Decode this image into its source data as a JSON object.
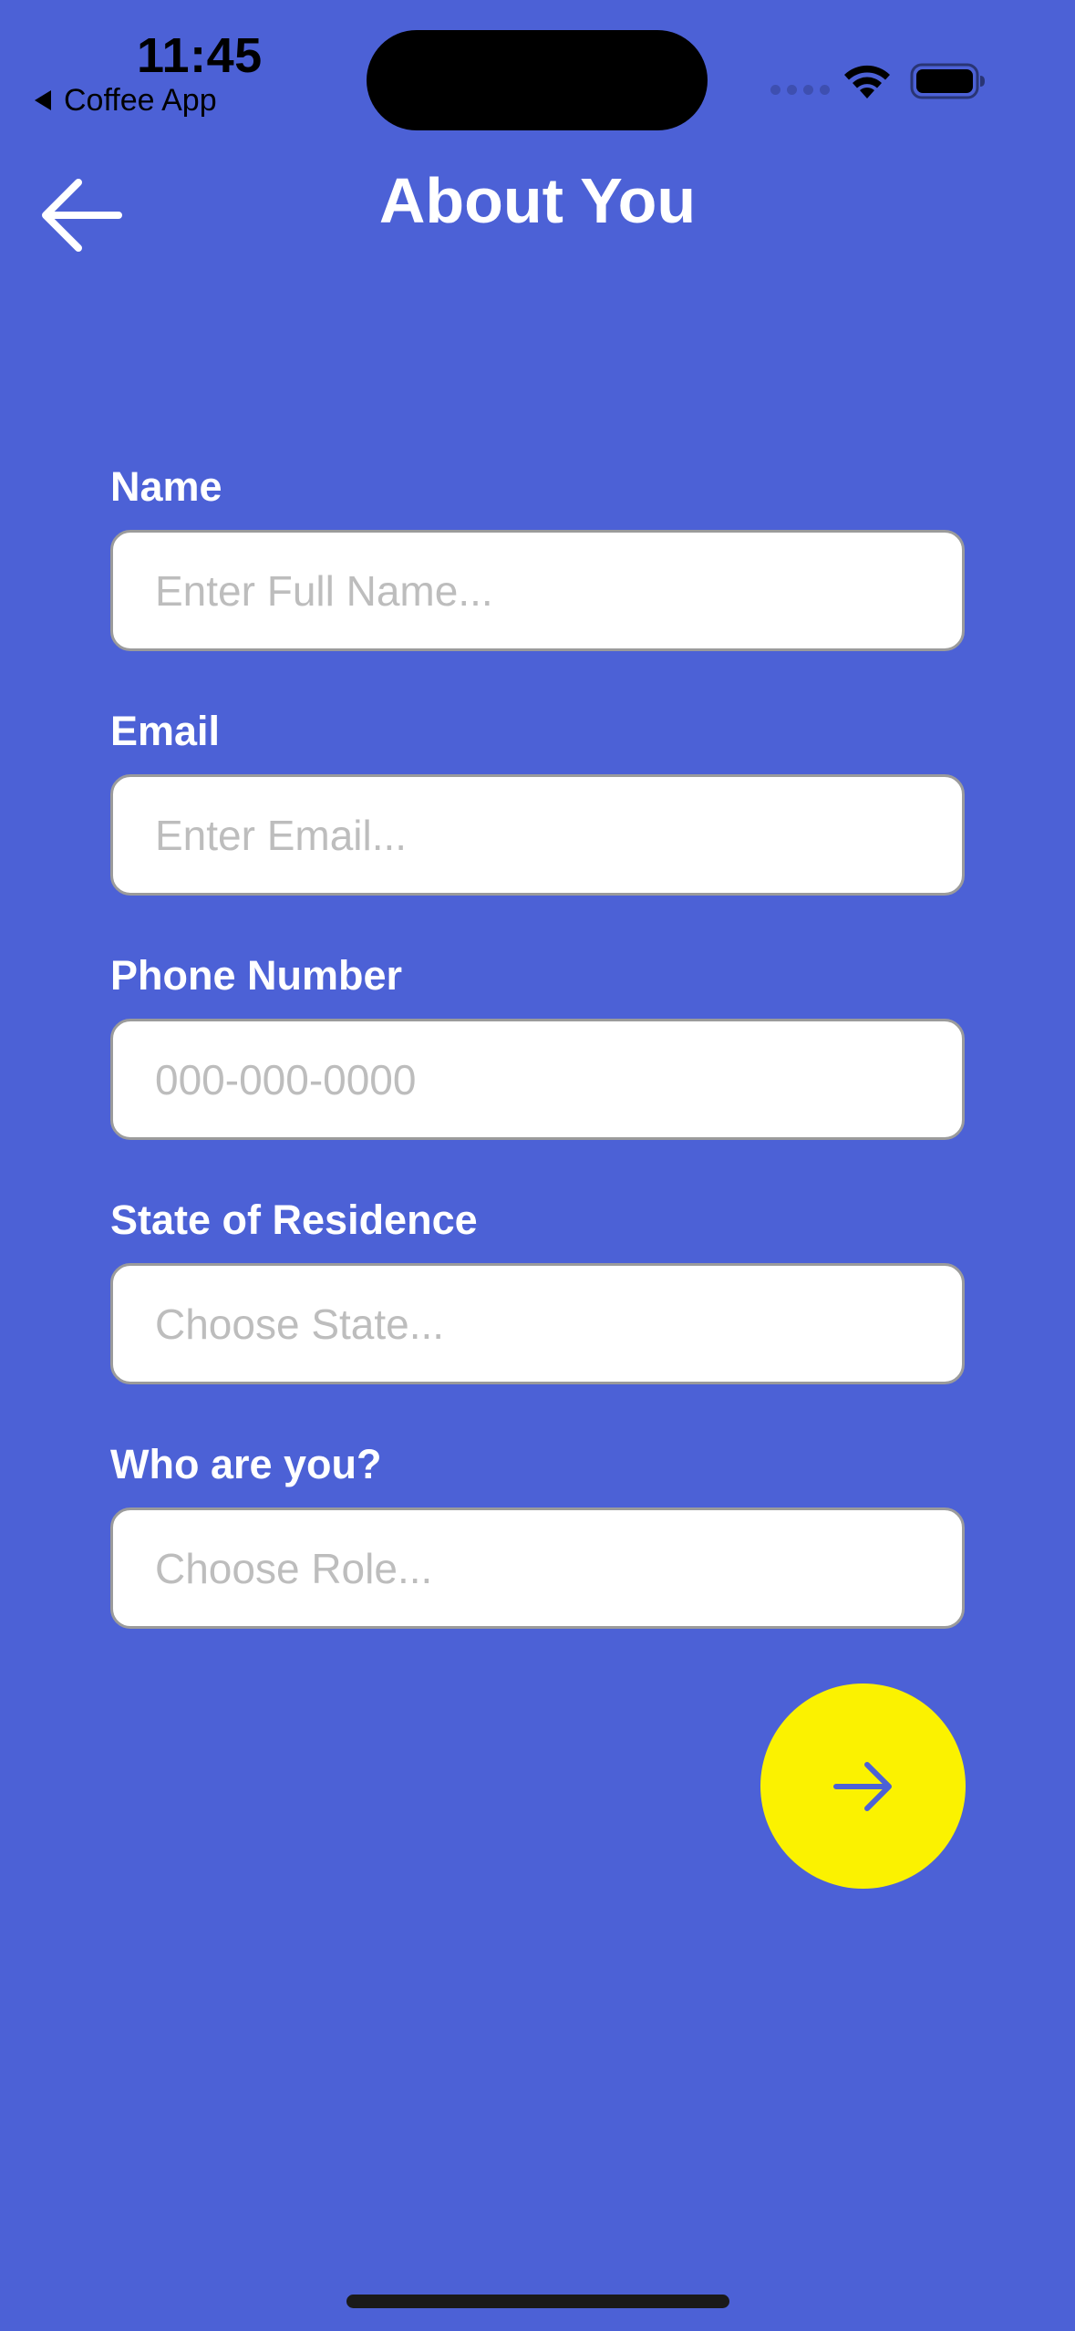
{
  "status_bar": {
    "time": "11:45",
    "back_app": "Coffee App"
  },
  "header": {
    "title": "About You",
    "back_icon": "arrow-left-icon"
  },
  "form": {
    "name": {
      "label": "Name",
      "placeholder": "Enter Full Name...",
      "value": ""
    },
    "email": {
      "label": "Email",
      "placeholder": "Enter Email...",
      "value": ""
    },
    "phone": {
      "label": "Phone Number",
      "placeholder": "000-000-0000",
      "value": ""
    },
    "state": {
      "label": "State of Residence",
      "placeholder": "Choose State...",
      "value": ""
    },
    "role": {
      "label": "Who are you?",
      "placeholder": "Choose Role...",
      "value": ""
    }
  },
  "next_button": {
    "icon": "arrow-right-icon"
  },
  "colors": {
    "background": "#4C61D6",
    "accent_button": "#FBF200",
    "text_light": "#FFFFFF",
    "placeholder": "#BDBDBD"
  }
}
